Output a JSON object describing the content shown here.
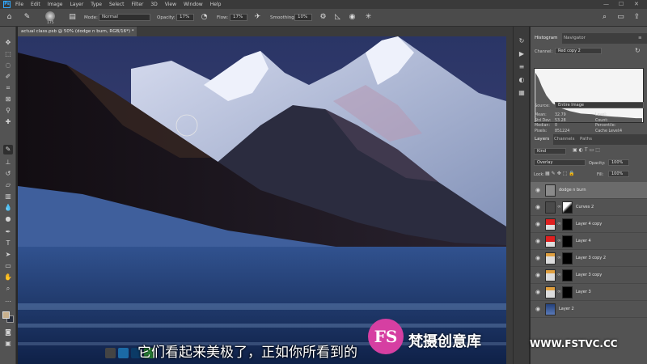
{
  "menubar": {
    "logo": "Ps",
    "items": [
      "File",
      "Edit",
      "Image",
      "Layer",
      "Type",
      "Select",
      "Filter",
      "3D",
      "View",
      "Window",
      "Help"
    ],
    "controls": [
      "—",
      "☐",
      "✕"
    ]
  },
  "options": {
    "brush_size": "175",
    "mode_label": "Mode:",
    "mode_value": "Normal",
    "opacity_label": "Opacity:",
    "opacity_value": "17%",
    "flow_label": "Flow:",
    "flow_value": "17%",
    "smoothing_label": "Smoothing:",
    "smoothing_value": "10%"
  },
  "document": {
    "tab_title": "actual class.psb @ 50% (dodge n burn, RGB/16*) *",
    "zoom": "50%"
  },
  "tools": [
    "move-icon",
    "marquee-icon",
    "lasso-icon",
    "quick-select-icon",
    "crop-icon",
    "eyedropper-icon",
    "healing-icon",
    "brush-icon",
    "stamp-icon",
    "history-brush-icon",
    "eraser-icon",
    "gradient-icon",
    "blur-icon",
    "dodge-icon",
    "pen-icon",
    "type-icon",
    "path-select-icon",
    "shape-icon",
    "hand-icon",
    "zoom-icon"
  ],
  "histogram": {
    "tabs": [
      "Histogram",
      "Navigator"
    ],
    "channel_label": "Channel:",
    "channel_value": "Red copy 2",
    "source_label": "Source:",
    "source_value": "Entire Image",
    "stats_left": [
      {
        "label": "Mean:",
        "value": "32.79"
      },
      {
        "label": "Std Dev:",
        "value": "53.28"
      },
      {
        "label": "Median:",
        "value": "0"
      },
      {
        "label": "Pixels:",
        "value": "851224"
      }
    ],
    "stats_right": [
      {
        "label": "Level:",
        "value": ""
      },
      {
        "label": "Count:",
        "value": ""
      },
      {
        "label": "Percentile:",
        "value": ""
      },
      {
        "label": "Cache Level:",
        "value": "4"
      }
    ]
  },
  "layers_panel": {
    "tabs": [
      "Layers",
      "Channels",
      "Paths"
    ],
    "filter_value": "Kind",
    "blend_mode": "Overlay",
    "opacity_label": "Opacity:",
    "opacity_value": "100%",
    "lock_label": "Lock:",
    "fill_label": "Fill:",
    "fill_value": "100%",
    "layers": [
      {
        "name": "dodge n burn",
        "selected": true
      },
      {
        "name": "Curves 2",
        "selected": false
      },
      {
        "name": "Layer 4 copy",
        "selected": false
      },
      {
        "name": "Layer 4",
        "selected": false
      },
      {
        "name": "Layer 3 copy 2",
        "selected": false
      },
      {
        "name": "Layer 3 copy",
        "selected": false
      },
      {
        "name": "Layer 3",
        "selected": false
      },
      {
        "name": "Layer 2",
        "selected": false
      }
    ]
  },
  "subtitle": "它们看起来美极了，正如你所看到的",
  "watermark": {
    "logo": "FS",
    "text": "梵摄创意库",
    "url": "WWW.FSTVC.CC"
  },
  "colors": {
    "accent": "#31a8ff",
    "panel_bg": "#535353",
    "watermark": "#d63fa2"
  }
}
